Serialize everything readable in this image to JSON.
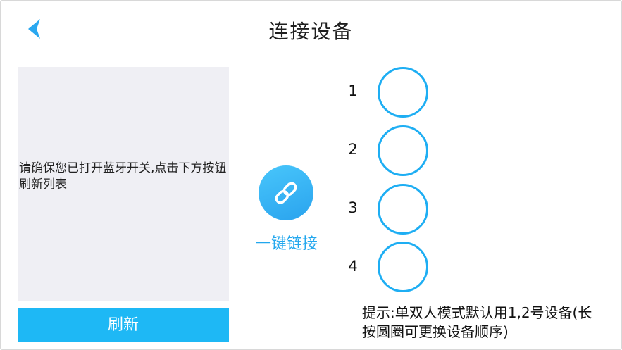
{
  "header": {
    "title": "连接设备",
    "back_icon": "chevron-left-icon"
  },
  "device_list": {
    "message": "请确保您已打开蓝牙开关,点击下方按钮刷新列表"
  },
  "refresh_button": {
    "label": "刷新"
  },
  "one_key_link": {
    "icon": "link-icon",
    "label": "一键链接"
  },
  "slots": [
    {
      "number": "1"
    },
    {
      "number": "2"
    },
    {
      "number": "3"
    },
    {
      "number": "4"
    }
  ],
  "hint": {
    "text": "提示:单双人模式默认用1,2号设备(长按圆圈可更换设备顺序)"
  },
  "colors": {
    "accent": "#1eb8f5",
    "link_text": "#22a7ee",
    "list_background": "#efeff4",
    "circle_border": "#1eaef3"
  }
}
